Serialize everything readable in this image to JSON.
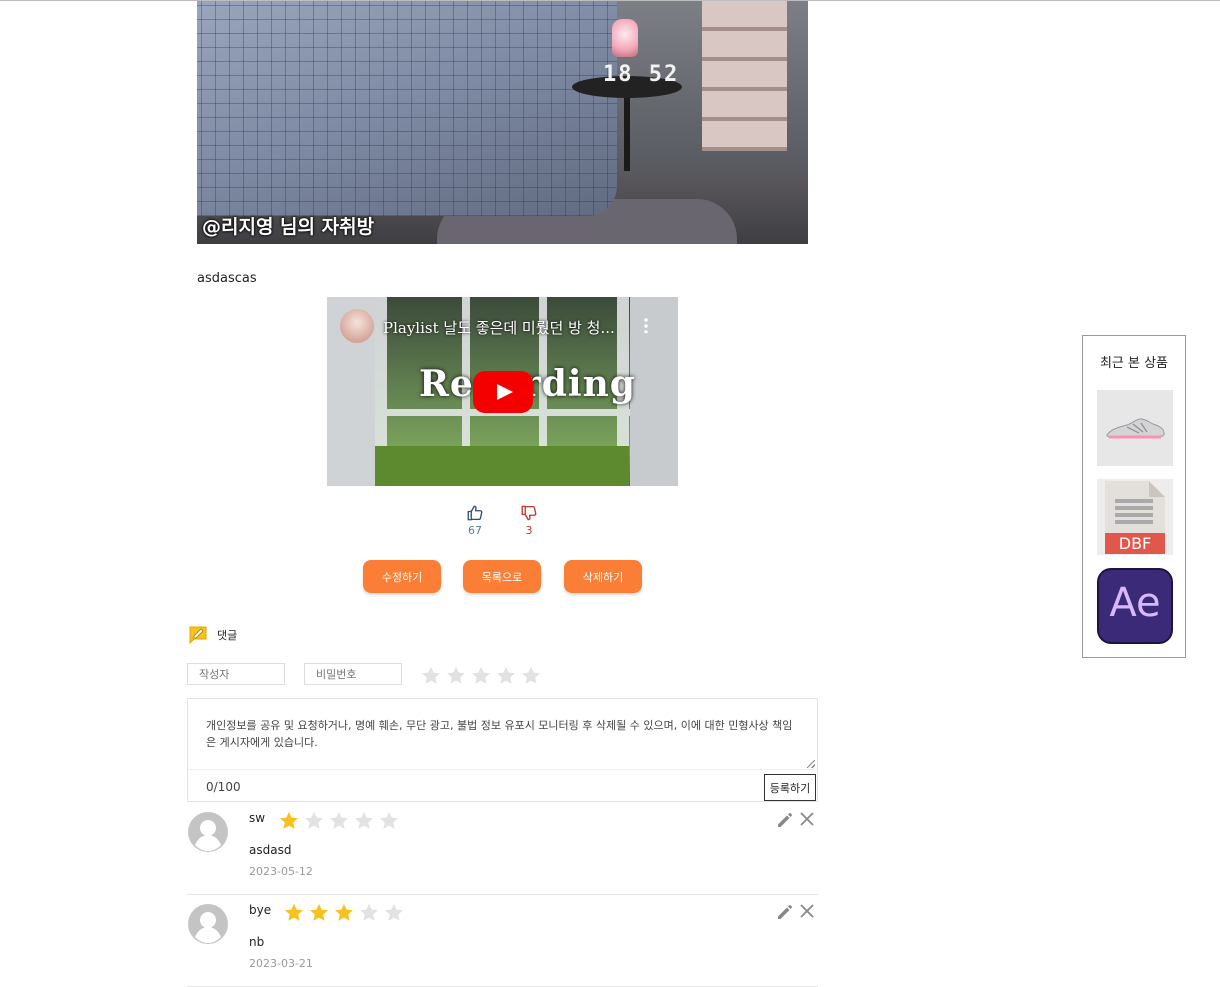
{
  "post": {
    "image_caption": "@리지영 님의 자취방",
    "clock_text": "18 52",
    "body_text": "asdascas"
  },
  "video": {
    "title": "Playlist 날도 좋은데 미뤘던 방 청...",
    "overlay_text": "Recording"
  },
  "votes": {
    "likes": "67",
    "dislikes": "3"
  },
  "actions": {
    "edit": "수정하기",
    "list": "목록으로",
    "delete": "삭제하기"
  },
  "comments_section": {
    "title": "댓글",
    "author_placeholder": "작성자",
    "password_placeholder": "비밀번호",
    "notice": "개인정보를 공유 및 요청하거나, 명예 훼손, 무단 광고, 불법 정보 유포시 모니터링 후 삭제될 수 있으며, 이에 대한 민형사상 책임은 게시자에게 있습니다.",
    "char_count": "0/100",
    "submit_label": "등록하기",
    "rating_selected": 0,
    "rating_max": 5
  },
  "comments": [
    {
      "author": "sw",
      "rating": 1,
      "text": "asdasd",
      "date": "2023-05-12"
    },
    {
      "author": "bye",
      "rating": 3,
      "text": "nb",
      "date": "2023-03-21"
    }
  ],
  "recent_panel": {
    "title": "최근 본 상품",
    "items": [
      {
        "icon": "sneaker-image"
      },
      {
        "icon": "dbf-file-icon",
        "label": "DBF"
      },
      {
        "icon": "after-effects-icon",
        "label": "Ae"
      }
    ]
  },
  "colors": {
    "accent": "#fb7e36",
    "star_on": "#f7c21e",
    "star_off": "#e2e2e2",
    "like": "#5b7aa0",
    "dislike": "#c0392b"
  }
}
